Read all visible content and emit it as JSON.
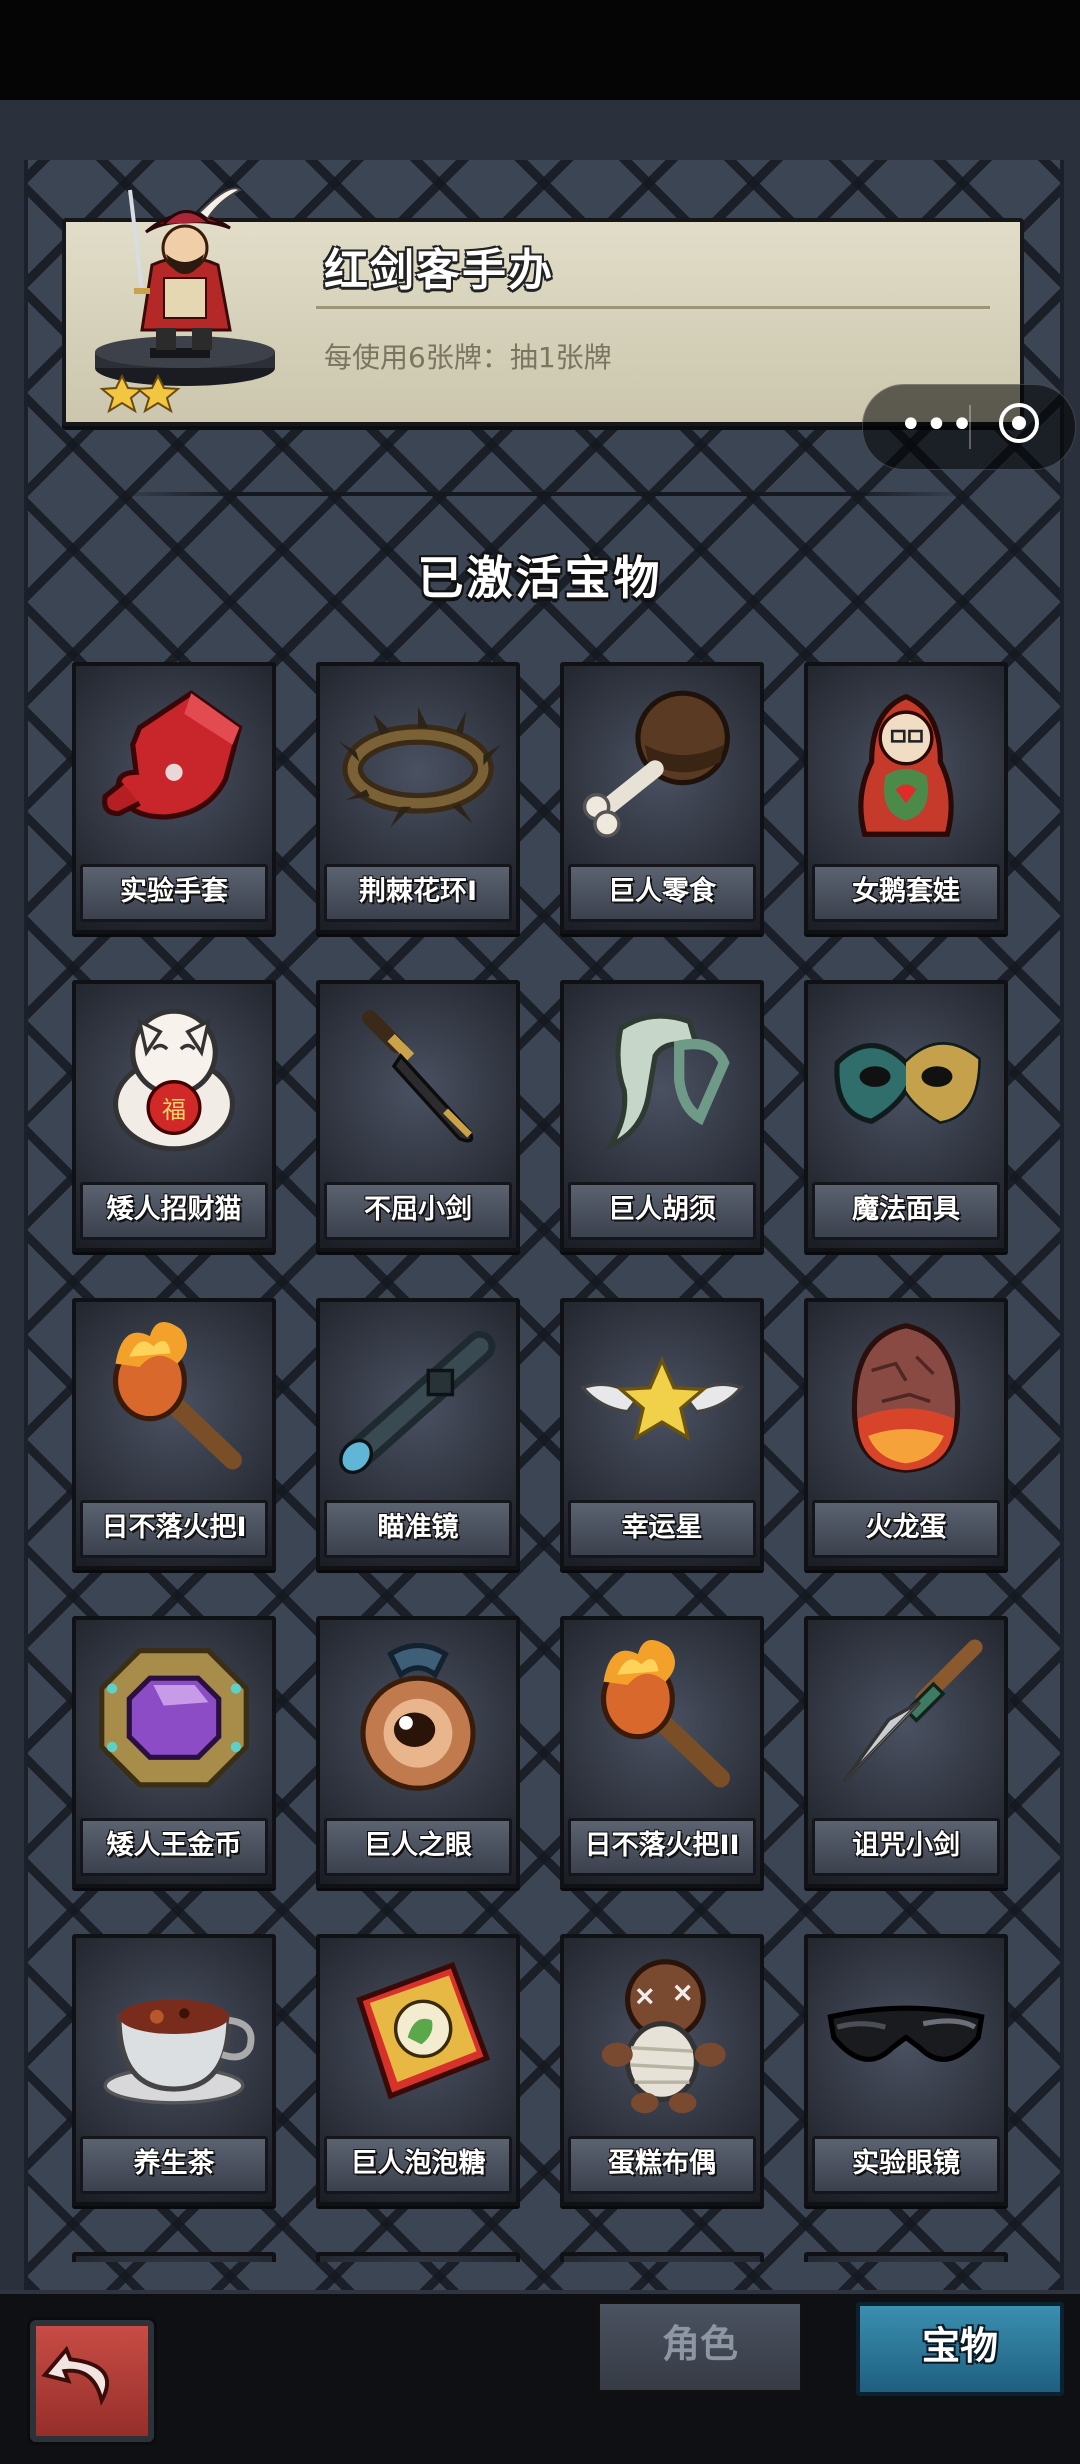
{
  "header": {
    "relic_name": "红剑客手办",
    "relic_desc": "每使用6张牌：抽1张牌",
    "relic_stars": 2
  },
  "capsule": {
    "more_icon": "more-dots-icon",
    "close_icon": "target-close-icon"
  },
  "section_title": "已激活宝物",
  "items": [
    {
      "label": "实验手套",
      "icon": "red-glove-icon"
    },
    {
      "label": "荆棘花环I",
      "icon": "thorn-wreath-icon"
    },
    {
      "label": "巨人零食",
      "icon": "bone-snack-icon"
    },
    {
      "label": "女鹅套娃",
      "icon": "matryoshka-doll-icon"
    },
    {
      "label": "矮人招财猫",
      "icon": "lucky-cat-icon"
    },
    {
      "label": "不屈小剑",
      "icon": "dagger-icon"
    },
    {
      "label": "巨人胡须",
      "icon": "beard-icon"
    },
    {
      "label": "魔法面具",
      "icon": "masquerade-mask-icon"
    },
    {
      "label": "日不落火把I",
      "icon": "torch-icon"
    },
    {
      "label": "瞄准镜",
      "icon": "scope-icon"
    },
    {
      "label": "幸运星",
      "icon": "winged-star-icon"
    },
    {
      "label": "火龙蛋",
      "icon": "dragon-egg-icon"
    },
    {
      "label": "矮人王金币",
      "icon": "gold-coin-gem-icon"
    },
    {
      "label": "巨人之眼",
      "icon": "eye-amulet-icon"
    },
    {
      "label": "日不落火把II",
      "icon": "torch-icon"
    },
    {
      "label": "诅咒小剑",
      "icon": "cursed-dagger-icon"
    },
    {
      "label": "养生茶",
      "icon": "tea-cup-icon"
    },
    {
      "label": "巨人泡泡糖",
      "icon": "bubble-gum-icon"
    },
    {
      "label": "蛋糕布偶",
      "icon": "voodoo-doll-icon"
    },
    {
      "label": "实验眼镜",
      "icon": "sunglasses-icon"
    }
  ],
  "tabs": {
    "role": "角色",
    "treasure": "宝物",
    "active": "treasure"
  },
  "back_icon": "return-arrow-icon",
  "colors": {
    "accent_tab": "#2a7597",
    "banner_bg": "#d8d3bd",
    "board": "#3c4554"
  }
}
